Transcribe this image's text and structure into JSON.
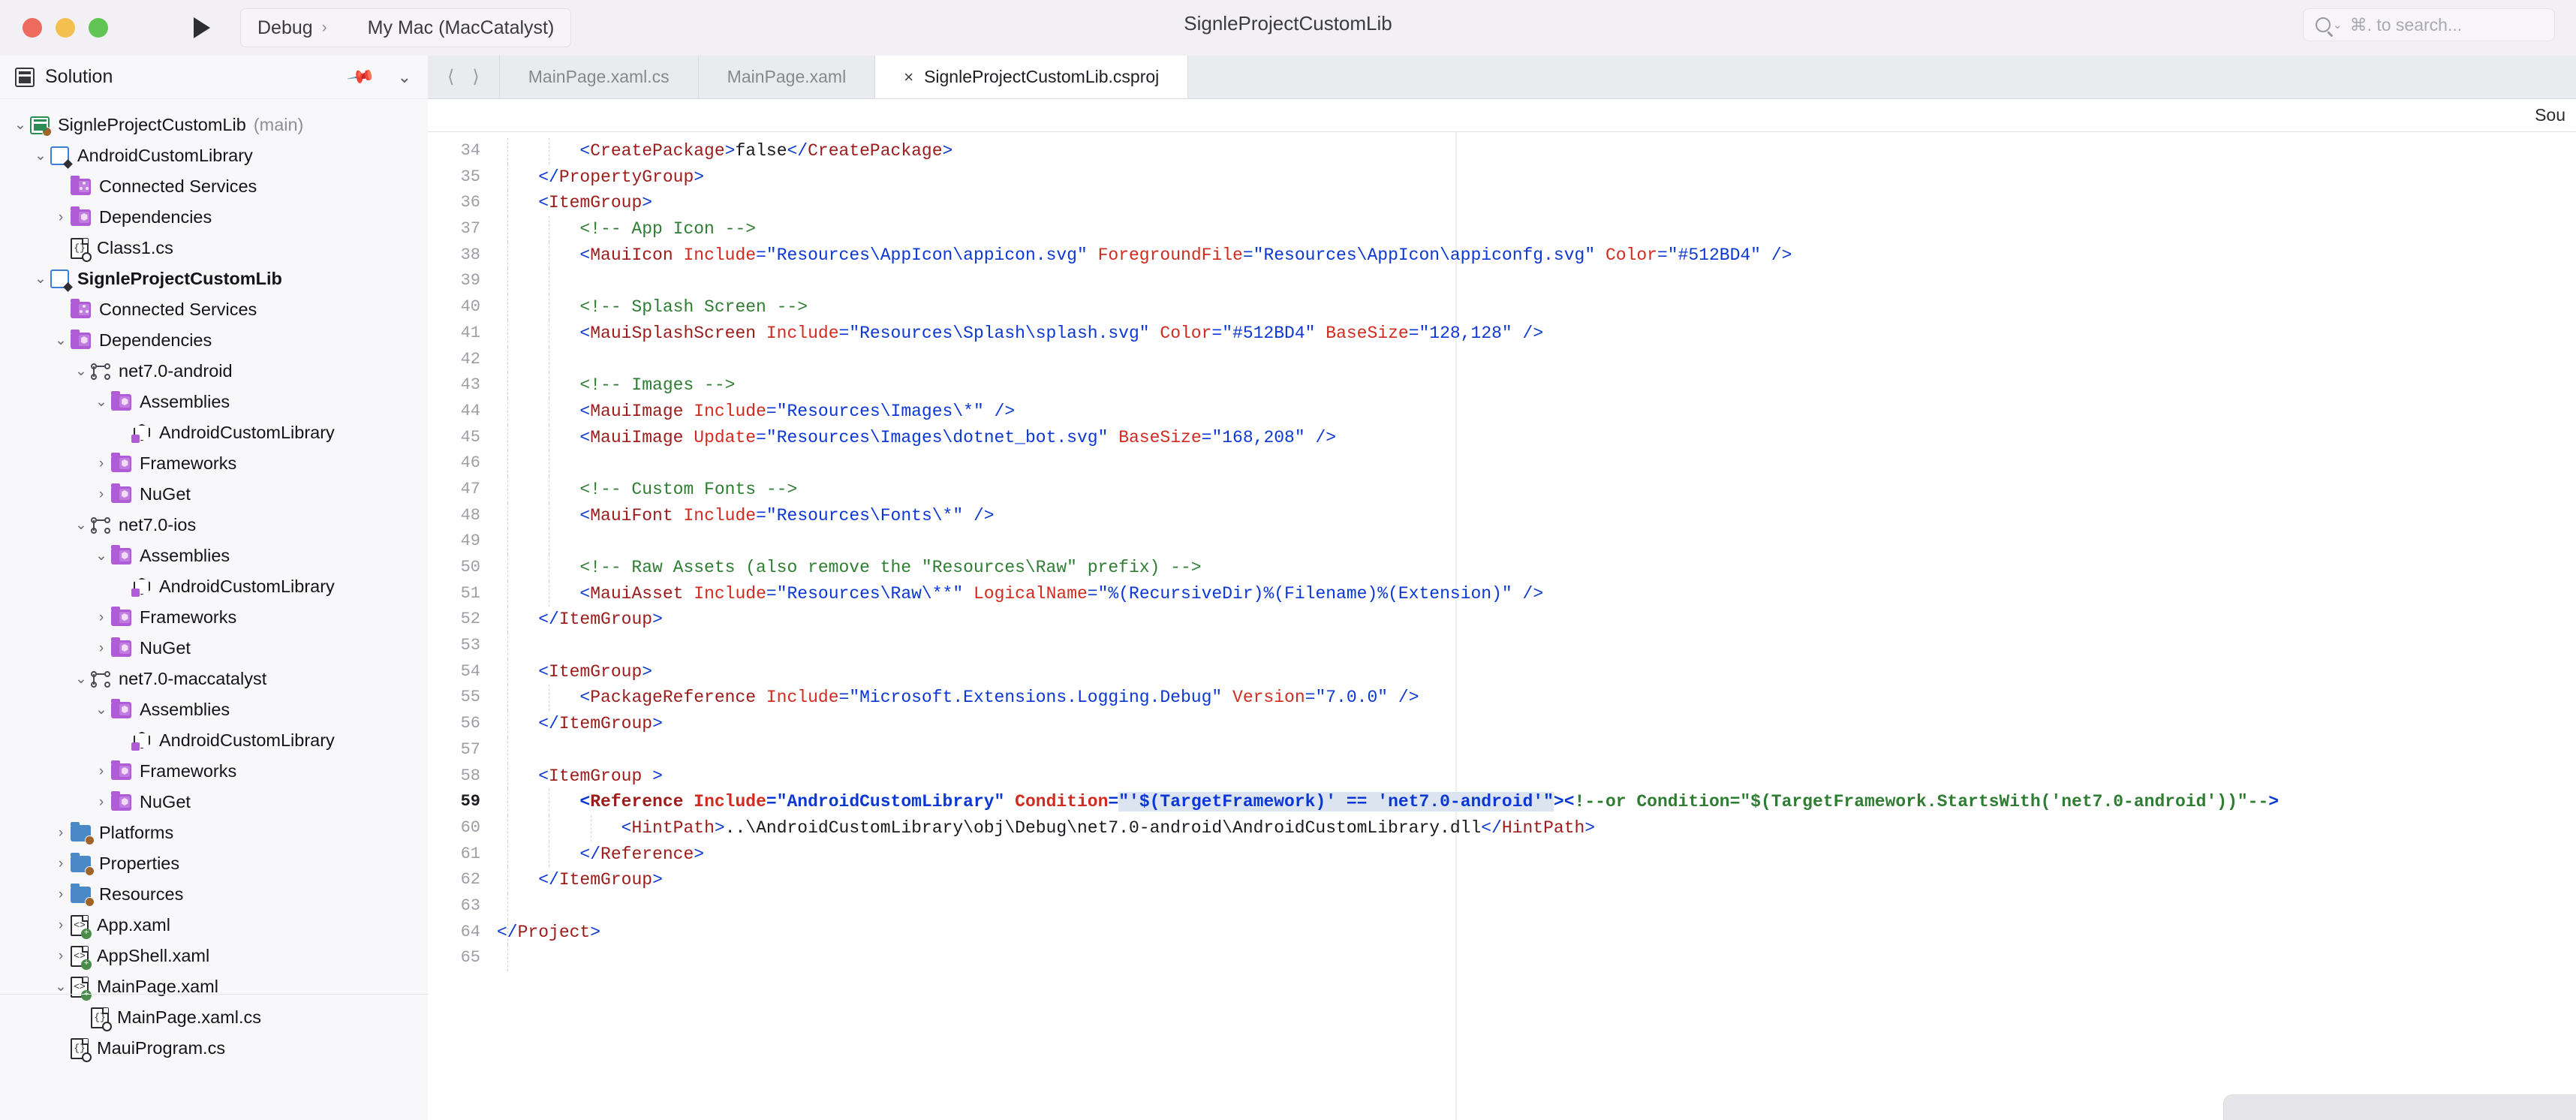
{
  "window": {
    "title": "SignleProjectCustomLib",
    "traffic_lights": [
      "close",
      "minimize",
      "zoom"
    ],
    "run_button_icon": "play-icon"
  },
  "toolbar": {
    "run_configuration": "Debug",
    "separator": "›",
    "device_icon": "monitor-icon",
    "device": "My Mac (MacCatalyst)"
  },
  "search": {
    "icon": "search-icon",
    "chevron": "⌄",
    "placeholder": "⌘. to search..."
  },
  "solution_panel": {
    "icon": "solution-icon",
    "title": "Solution",
    "pin_icon": "pin-icon",
    "collapse_icon": "chevron-down-icon",
    "tree": [
      {
        "label": "SignleProjectCustomLib",
        "sub": "(main)",
        "indent": 0,
        "twisty": "⌄",
        "icon": "solution-node-icon",
        "bold": false
      },
      {
        "label": "AndroidCustomLibrary",
        "sub": "",
        "indent": 1,
        "twisty": "⌄",
        "icon": "project-icon",
        "bold": false
      },
      {
        "label": "Connected Services",
        "sub": "",
        "indent": 2,
        "twisty": "",
        "icon": "connected-services-folder-icon",
        "bold": false
      },
      {
        "label": "Dependencies",
        "sub": "",
        "indent": 2,
        "twisty": "›",
        "icon": "dependencies-folder-icon",
        "bold": false
      },
      {
        "label": "Class1.cs",
        "sub": "",
        "indent": 2,
        "twisty": "",
        "icon": "csharp-file-icon",
        "bold": false
      },
      {
        "label": "SignleProjectCustomLib",
        "sub": "",
        "indent": 1,
        "twisty": "⌄",
        "icon": "project-icon",
        "bold": true
      },
      {
        "label": "Connected Services",
        "sub": "",
        "indent": 2,
        "twisty": "",
        "icon": "connected-services-folder-icon",
        "bold": false
      },
      {
        "label": "Dependencies",
        "sub": "",
        "indent": 2,
        "twisty": "⌄",
        "icon": "dependencies-folder-icon",
        "bold": false
      },
      {
        "label": "net7.0-android",
        "sub": "",
        "indent": 3,
        "twisty": "⌄",
        "icon": "target-framework-icon",
        "bold": false
      },
      {
        "label": "Assemblies",
        "sub": "",
        "indent": 4,
        "twisty": "⌄",
        "icon": "dependencies-folder-icon",
        "bold": false
      },
      {
        "label": "AndroidCustomLibrary",
        "sub": "",
        "indent": 5,
        "twisty": "",
        "icon": "assembly-icon",
        "bold": false
      },
      {
        "label": "Frameworks",
        "sub": "",
        "indent": 4,
        "twisty": "›",
        "icon": "dependencies-folder-icon",
        "bold": false
      },
      {
        "label": "NuGet",
        "sub": "",
        "indent": 4,
        "twisty": "›",
        "icon": "dependencies-folder-icon",
        "bold": false
      },
      {
        "label": "net7.0-ios",
        "sub": "",
        "indent": 3,
        "twisty": "⌄",
        "icon": "target-framework-icon",
        "bold": false
      },
      {
        "label": "Assemblies",
        "sub": "",
        "indent": 4,
        "twisty": "⌄",
        "icon": "dependencies-folder-icon",
        "bold": false
      },
      {
        "label": "AndroidCustomLibrary",
        "sub": "",
        "indent": 5,
        "twisty": "",
        "icon": "assembly-icon",
        "bold": false
      },
      {
        "label": "Frameworks",
        "sub": "",
        "indent": 4,
        "twisty": "›",
        "icon": "dependencies-folder-icon",
        "bold": false
      },
      {
        "label": "NuGet",
        "sub": "",
        "indent": 4,
        "twisty": "›",
        "icon": "dependencies-folder-icon",
        "bold": false
      },
      {
        "label": "net7.0-maccatalyst",
        "sub": "",
        "indent": 3,
        "twisty": "⌄",
        "icon": "target-framework-icon",
        "bold": false
      },
      {
        "label": "Assemblies",
        "sub": "",
        "indent": 4,
        "twisty": "⌄",
        "icon": "dependencies-folder-icon",
        "bold": false
      },
      {
        "label": "AndroidCustomLibrary",
        "sub": "",
        "indent": 5,
        "twisty": "",
        "icon": "assembly-icon",
        "bold": false
      },
      {
        "label": "Frameworks",
        "sub": "",
        "indent": 4,
        "twisty": "›",
        "icon": "dependencies-folder-icon",
        "bold": false
      },
      {
        "label": "NuGet",
        "sub": "",
        "indent": 4,
        "twisty": "›",
        "icon": "dependencies-folder-icon",
        "bold": false
      },
      {
        "label": "Platforms",
        "sub": "",
        "indent": 2,
        "twisty": "›",
        "icon": "blue-folder-icon",
        "bold": false
      },
      {
        "label": "Properties",
        "sub": "",
        "indent": 2,
        "twisty": "›",
        "icon": "blue-folder-icon",
        "bold": false
      },
      {
        "label": "Resources",
        "sub": "",
        "indent": 2,
        "twisty": "›",
        "icon": "blue-folder-icon",
        "bold": false
      },
      {
        "label": "App.xaml",
        "sub": "",
        "indent": 2,
        "twisty": "›",
        "icon": "xaml-file-icon",
        "bold": false
      },
      {
        "label": "AppShell.xaml",
        "sub": "",
        "indent": 2,
        "twisty": "›",
        "icon": "xaml-file-icon",
        "bold": false
      },
      {
        "label": "MainPage.xaml",
        "sub": "",
        "indent": 2,
        "twisty": "⌄",
        "icon": "xaml-file-icon",
        "bold": false
      },
      {
        "label": "MainPage.xaml.cs",
        "sub": "",
        "indent": 3,
        "twisty": "",
        "icon": "csharp-file-icon",
        "bold": false
      },
      {
        "label": "MauiProgram.cs",
        "sub": "",
        "indent": 2,
        "twisty": "",
        "icon": "csharp-file-icon",
        "bold": false
      }
    ]
  },
  "tabbar": {
    "back_icon": "chevron-left-icon",
    "forward_icon": "chevron-right-icon",
    "tabs": [
      {
        "label": "MainPage.xaml.cs",
        "active": false,
        "closable": false
      },
      {
        "label": "MainPage.xaml",
        "active": false,
        "closable": false
      },
      {
        "label": "SignleProjectCustomLib.csproj",
        "active": true,
        "closable": true,
        "close_glyph": "×"
      }
    ]
  },
  "source_strip": {
    "label": "Sou"
  },
  "editor": {
    "current_line": 59,
    "first_line": 34,
    "last_line": 65,
    "colors": {
      "tag": "#9C1B1B",
      "bracket": "#0B37D4",
      "attribute": "#D12B1F",
      "value": "#0B37D4",
      "comment": "#2E7D32",
      "text": "#1A1A1F",
      "selection": "#DCE4EF",
      "line_number": "#9E9EA6"
    },
    "lines": [
      {
        "n": 34,
        "indent": 2,
        "tokens": [
          {
            "t": "br",
            "v": "<"
          },
          {
            "t": "tg",
            "v": "CreatePackage"
          },
          {
            "t": "br",
            "v": ">"
          },
          {
            "t": "tx",
            "v": "false"
          },
          {
            "t": "br",
            "v": "</"
          },
          {
            "t": "tg",
            "v": "CreatePackage"
          },
          {
            "t": "br",
            "v": ">"
          }
        ]
      },
      {
        "n": 35,
        "indent": 1,
        "tokens": [
          {
            "t": "br",
            "v": "</"
          },
          {
            "t": "tg",
            "v": "PropertyGroup"
          },
          {
            "t": "br",
            "v": ">"
          }
        ]
      },
      {
        "n": 36,
        "indent": 1,
        "tokens": [
          {
            "t": "br",
            "v": "<"
          },
          {
            "t": "tg",
            "v": "ItemGroup"
          },
          {
            "t": "br",
            "v": ">"
          }
        ]
      },
      {
        "n": 37,
        "indent": 2,
        "tokens": [
          {
            "t": "cm",
            "v": "<!-- App Icon -->"
          }
        ]
      },
      {
        "n": 38,
        "indent": 2,
        "tokens": [
          {
            "t": "br",
            "v": "<"
          },
          {
            "t": "tg",
            "v": "MauiIcon "
          },
          {
            "t": "at",
            "v": "Include"
          },
          {
            "t": "br",
            "v": "="
          },
          {
            "t": "vl",
            "v": "\"Resources\\AppIcon\\appicon.svg\""
          },
          {
            "t": "tx",
            "v": " "
          },
          {
            "t": "at",
            "v": "ForegroundFile"
          },
          {
            "t": "br",
            "v": "="
          },
          {
            "t": "vl",
            "v": "\"Resources\\AppIcon\\appiconfg.svg\""
          },
          {
            "t": "tx",
            "v": " "
          },
          {
            "t": "at",
            "v": "Color"
          },
          {
            "t": "br",
            "v": "="
          },
          {
            "t": "vl",
            "v": "\"#512BD4\""
          },
          {
            "t": "tx",
            "v": " "
          },
          {
            "t": "br",
            "v": "/>"
          }
        ]
      },
      {
        "n": 39,
        "indent": 2,
        "tokens": []
      },
      {
        "n": 40,
        "indent": 2,
        "tokens": [
          {
            "t": "cm",
            "v": "<!-- Splash Screen -->"
          }
        ]
      },
      {
        "n": 41,
        "indent": 2,
        "tokens": [
          {
            "t": "br",
            "v": "<"
          },
          {
            "t": "tg",
            "v": "MauiSplashScreen "
          },
          {
            "t": "at",
            "v": "Include"
          },
          {
            "t": "br",
            "v": "="
          },
          {
            "t": "vl",
            "v": "\"Resources\\Splash\\splash.svg\""
          },
          {
            "t": "tx",
            "v": " "
          },
          {
            "t": "at",
            "v": "Color"
          },
          {
            "t": "br",
            "v": "="
          },
          {
            "t": "vl",
            "v": "\"#512BD4\""
          },
          {
            "t": "tx",
            "v": " "
          },
          {
            "t": "at",
            "v": "BaseSize"
          },
          {
            "t": "br",
            "v": "="
          },
          {
            "t": "vl",
            "v": "\"128,128\""
          },
          {
            "t": "tx",
            "v": " "
          },
          {
            "t": "br",
            "v": "/>"
          }
        ]
      },
      {
        "n": 42,
        "indent": 2,
        "tokens": []
      },
      {
        "n": 43,
        "indent": 2,
        "tokens": [
          {
            "t": "cm",
            "v": "<!-- Images -->"
          }
        ]
      },
      {
        "n": 44,
        "indent": 2,
        "tokens": [
          {
            "t": "br",
            "v": "<"
          },
          {
            "t": "tg",
            "v": "MauiImage "
          },
          {
            "t": "at",
            "v": "Include"
          },
          {
            "t": "br",
            "v": "="
          },
          {
            "t": "vl",
            "v": "\"Resources\\Images\\*\""
          },
          {
            "t": "tx",
            "v": " "
          },
          {
            "t": "br",
            "v": "/>"
          }
        ]
      },
      {
        "n": 45,
        "indent": 2,
        "tokens": [
          {
            "t": "br",
            "v": "<"
          },
          {
            "t": "tg",
            "v": "MauiImage "
          },
          {
            "t": "at",
            "v": "Update"
          },
          {
            "t": "br",
            "v": "="
          },
          {
            "t": "vl",
            "v": "\"Resources\\Images\\dotnet_bot.svg\""
          },
          {
            "t": "tx",
            "v": " "
          },
          {
            "t": "at",
            "v": "BaseSize"
          },
          {
            "t": "br",
            "v": "="
          },
          {
            "t": "vl",
            "v": "\"168,208\""
          },
          {
            "t": "tx",
            "v": " "
          },
          {
            "t": "br",
            "v": "/>"
          }
        ]
      },
      {
        "n": 46,
        "indent": 2,
        "tokens": []
      },
      {
        "n": 47,
        "indent": 2,
        "tokens": [
          {
            "t": "cm",
            "v": "<!-- Custom Fonts -->"
          }
        ]
      },
      {
        "n": 48,
        "indent": 2,
        "tokens": [
          {
            "t": "br",
            "v": "<"
          },
          {
            "t": "tg",
            "v": "MauiFont "
          },
          {
            "t": "at",
            "v": "Include"
          },
          {
            "t": "br",
            "v": "="
          },
          {
            "t": "vl",
            "v": "\"Resources\\Fonts\\*\""
          },
          {
            "t": "tx",
            "v": " "
          },
          {
            "t": "br",
            "v": "/>"
          }
        ]
      },
      {
        "n": 49,
        "indent": 2,
        "tokens": []
      },
      {
        "n": 50,
        "indent": 2,
        "tokens": [
          {
            "t": "cm",
            "v": "<!-- Raw Assets (also remove the \"Resources\\Raw\" prefix) -->"
          }
        ]
      },
      {
        "n": 51,
        "indent": 2,
        "tokens": [
          {
            "t": "br",
            "v": "<"
          },
          {
            "t": "tg",
            "v": "MauiAsset "
          },
          {
            "t": "at",
            "v": "Include"
          },
          {
            "t": "br",
            "v": "="
          },
          {
            "t": "vl",
            "v": "\"Resources\\Raw\\**\""
          },
          {
            "t": "tx",
            "v": " "
          },
          {
            "t": "at",
            "v": "LogicalName"
          },
          {
            "t": "br",
            "v": "="
          },
          {
            "t": "vl",
            "v": "\"%(RecursiveDir)%(Filename)%(Extension)\""
          },
          {
            "t": "tx",
            "v": " "
          },
          {
            "t": "br",
            "v": "/>"
          }
        ]
      },
      {
        "n": 52,
        "indent": 1,
        "tokens": [
          {
            "t": "br",
            "v": "</"
          },
          {
            "t": "tg",
            "v": "ItemGroup"
          },
          {
            "t": "br",
            "v": ">"
          }
        ]
      },
      {
        "n": 53,
        "indent": 1,
        "tokens": []
      },
      {
        "n": 54,
        "indent": 1,
        "tokens": [
          {
            "t": "br",
            "v": "<"
          },
          {
            "t": "tg",
            "v": "ItemGroup"
          },
          {
            "t": "br",
            "v": ">"
          }
        ]
      },
      {
        "n": 55,
        "indent": 2,
        "tokens": [
          {
            "t": "br",
            "v": "<"
          },
          {
            "t": "tg",
            "v": "PackageReference "
          },
          {
            "t": "at",
            "v": "Include"
          },
          {
            "t": "br",
            "v": "="
          },
          {
            "t": "vl",
            "v": "\"Microsoft.Extensions.Logging.Debug\""
          },
          {
            "t": "tx",
            "v": " "
          },
          {
            "t": "at",
            "v": "Version"
          },
          {
            "t": "br",
            "v": "="
          },
          {
            "t": "vl",
            "v": "\"7.0.0\""
          },
          {
            "t": "tx",
            "v": " "
          },
          {
            "t": "br",
            "v": "/>"
          }
        ]
      },
      {
        "n": 56,
        "indent": 1,
        "tokens": [
          {
            "t": "br",
            "v": "</"
          },
          {
            "t": "tg",
            "v": "ItemGroup"
          },
          {
            "t": "br",
            "v": ">"
          }
        ]
      },
      {
        "n": 57,
        "indent": 1,
        "tokens": []
      },
      {
        "n": 58,
        "indent": 1,
        "tokens": [
          {
            "t": "br",
            "v": "<"
          },
          {
            "t": "tg",
            "v": "ItemGroup "
          },
          {
            "t": "br",
            "v": ">"
          }
        ]
      },
      {
        "n": 59,
        "indent": 2,
        "current": true,
        "tokens": [
          {
            "t": "br",
            "v": "<"
          },
          {
            "t": "tg",
            "v": "Reference "
          },
          {
            "t": "at",
            "v": "Include"
          },
          {
            "t": "br",
            "v": "="
          },
          {
            "t": "vl",
            "v": "\"AndroidCustomLibrary\""
          },
          {
            "t": "tx",
            "v": " "
          },
          {
            "t": "at",
            "v": "Condition"
          },
          {
            "t": "br",
            "v": "="
          },
          {
            "t": "vl sel",
            "v": "\"'$(TargetFramework)' == 'net7.0-android'\""
          },
          {
            "t": "br",
            "v": "><"
          },
          {
            "t": "cm",
            "v": "!--or Condition=\"$(TargetFramework.StartsWith('net7.0-android'))\"--"
          },
          {
            "t": "br",
            "v": ">"
          }
        ]
      },
      {
        "n": 60,
        "indent": 3,
        "tokens": [
          {
            "t": "br",
            "v": "<"
          },
          {
            "t": "tg",
            "v": "HintPath"
          },
          {
            "t": "br",
            "v": ">"
          },
          {
            "t": "tx",
            "v": "..\\AndroidCustomLibrary\\obj\\Debug\\net7.0-android\\AndroidCustomLibrary.dll"
          },
          {
            "t": "br",
            "v": "</"
          },
          {
            "t": "tg",
            "v": "HintPath"
          },
          {
            "t": "br",
            "v": ">"
          }
        ]
      },
      {
        "n": 61,
        "indent": 2,
        "tokens": [
          {
            "t": "br",
            "v": "</"
          },
          {
            "t": "tg",
            "v": "Reference"
          },
          {
            "t": "br",
            "v": ">"
          }
        ]
      },
      {
        "n": 62,
        "indent": 1,
        "tokens": [
          {
            "t": "br",
            "v": "</"
          },
          {
            "t": "tg",
            "v": "ItemGroup"
          },
          {
            "t": "br",
            "v": ">"
          }
        ]
      },
      {
        "n": 63,
        "indent": 1,
        "tokens": []
      },
      {
        "n": 64,
        "indent": 0,
        "tokens": [
          {
            "t": "br",
            "v": "</"
          },
          {
            "t": "tg",
            "v": "Project"
          },
          {
            "t": "br",
            "v": ">"
          }
        ]
      },
      {
        "n": 65,
        "indent": 0,
        "tokens": []
      }
    ]
  }
}
